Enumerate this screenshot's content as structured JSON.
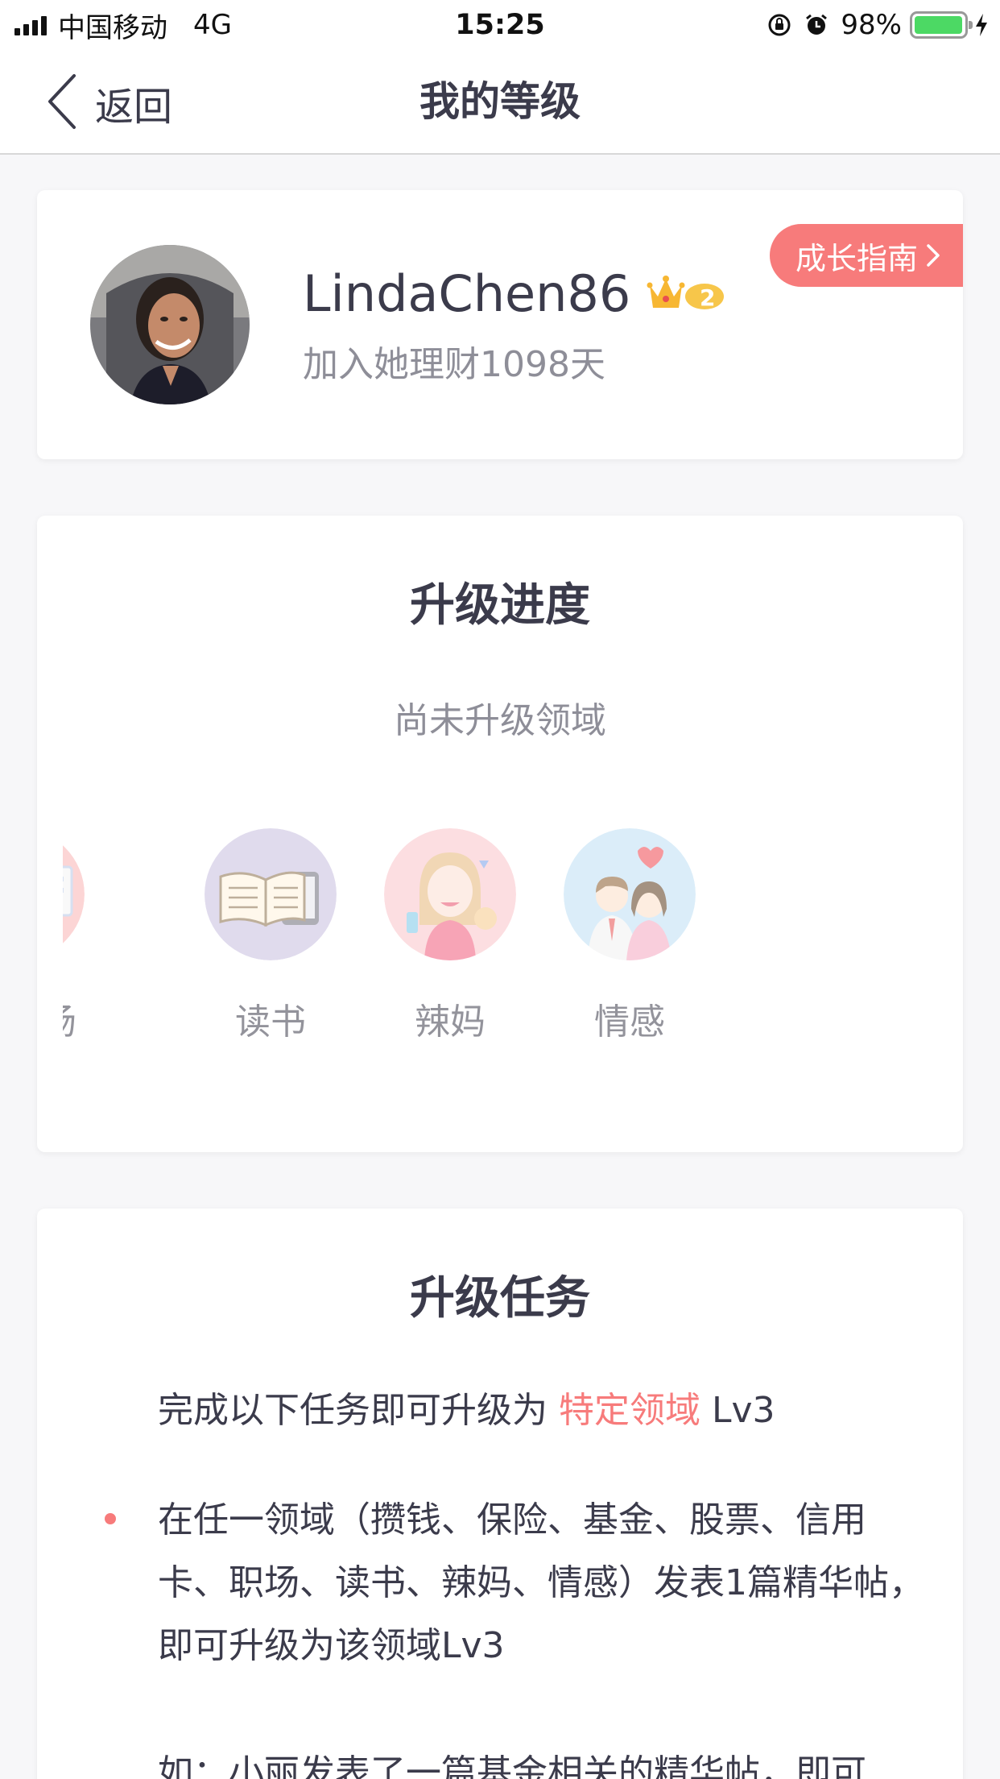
{
  "status_bar": {
    "carrier": "中国移动",
    "network": "4G",
    "time": "15:25",
    "battery": "98%",
    "battery_level": 0.98
  },
  "nav": {
    "back_label": "返回",
    "title": "我的等级"
  },
  "profile": {
    "username": "LindaChen86",
    "join_text": "加入她理财1098天",
    "guide_label": "成长指南",
    "level": 2
  },
  "progress": {
    "title": "升级进度",
    "subtitle": "尚未升级领域",
    "domains": [
      {
        "label": "场",
        "icon": "workplace-icon"
      },
      {
        "label": "读书",
        "icon": "book-icon"
      },
      {
        "label": "辣妈",
        "icon": "mom-icon"
      },
      {
        "label": "情感",
        "icon": "couple-icon"
      }
    ]
  },
  "tasks": {
    "title": "升级任务",
    "intro_prefix": "完成以下任务即可升级为 ",
    "intro_highlight": "特定领域",
    "intro_suffix": " Lv3",
    "item_text": "在任一领域（攒钱、保险、基金、股票、信用卡、职场、读书、辣妈、情感）发表1篇精华帖，即可升级为该领域Lv3",
    "example_text": "如：小丽发表了一篇基金相关的精华帖，即可"
  },
  "colors": {
    "accent": "#f77b7b",
    "text": "#3b3b4b",
    "muted": "#8e8e98"
  }
}
